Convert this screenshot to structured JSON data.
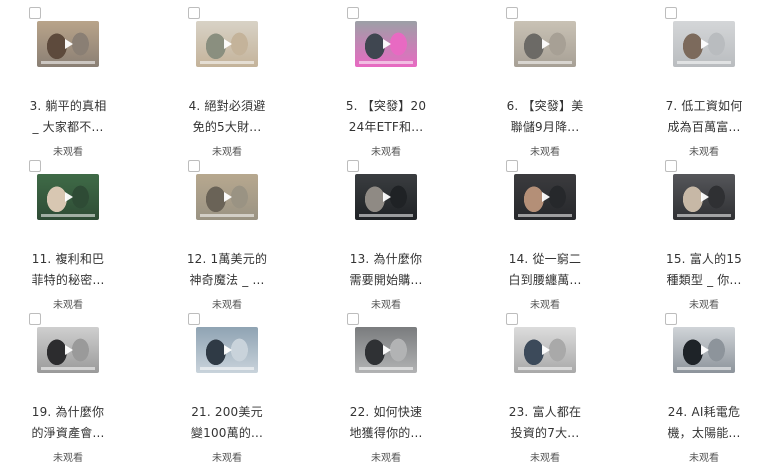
{
  "videos": [
    {
      "title_line1": "3. 躺平的真相",
      "title_line2": "_ 大家都不...",
      "status": "未观看",
      "thumb_colors": [
        "#b9a48a",
        "#5d4a3c",
        "#8a7f74"
      ]
    },
    {
      "title_line1": "4. 絕對必須避",
      "title_line2": "免的5大財...",
      "status": "未观看",
      "thumb_colors": [
        "#d8d2c6",
        "#8a8f7f",
        "#c4b39a"
      ]
    },
    {
      "title_line1": "5. 【突發】20",
      "title_line2": "24年ETF和...",
      "status": "未观看",
      "thumb_colors": [
        "#9ca0a6",
        "#3f4650",
        "#e86ac2"
      ]
    },
    {
      "title_line1": "6. 【突發】美",
      "title_line2": "聯儲9月降...",
      "status": "未观看",
      "thumb_colors": [
        "#c9c2b5",
        "#6c6a66",
        "#a7a095"
      ]
    },
    {
      "title_line1": "7. 低工資如何",
      "title_line2": "成為百萬富...",
      "status": "未观看",
      "thumb_colors": [
        "#d4d6d8",
        "#7c6a5c",
        "#b9bcbf"
      ]
    },
    {
      "title_line1": "11. 複利和巴",
      "title_line2": "菲特的秘密...",
      "status": "未观看",
      "thumb_colors": [
        "#3f6b47",
        "#d8c7b2",
        "#2e4b35"
      ]
    },
    {
      "title_line1": "12. 1萬美元的",
      "title_line2": "神奇魔法 _ ...",
      "status": "未观看",
      "thumb_colors": [
        "#b7a88f",
        "#6a6357",
        "#9a9383"
      ]
    },
    {
      "title_line1": "13. 為什麼你",
      "title_line2": "需要開始購...",
      "status": "未观看",
      "thumb_colors": [
        "#3a3d40",
        "#8f8a84",
        "#1f2225"
      ]
    },
    {
      "title_line1": "14. 從一窮二",
      "title_line2": "白到腰纏萬...",
      "status": "未观看",
      "thumb_colors": [
        "#3b3b3e",
        "#b48f77",
        "#26282b"
      ]
    },
    {
      "title_line1": "15. 富人的15",
      "title_line2": "種類型 _ 你...",
      "status": "未观看",
      "thumb_colors": [
        "#55565a",
        "#c7b8a6",
        "#2f3033"
      ]
    },
    {
      "title_line1": "19. 為什麼你",
      "title_line2": "的淨資產會...",
      "status": "未观看",
      "thumb_colors": [
        "#cfcfcf",
        "#2c2c2e",
        "#9a9a9a"
      ]
    },
    {
      "title_line1": "21. 200美元",
      "title_line2": "變100萬的...",
      "status": "未观看",
      "thumb_colors": [
        "#8fa3b3",
        "#2f3a45",
        "#c9d3db"
      ]
    },
    {
      "title_line1": "22. 如何快速",
      "title_line2": "地獲得你的...",
      "status": "未观看",
      "thumb_colors": [
        "#7a7c7e",
        "#2f3134",
        "#b2b3b4"
      ]
    },
    {
      "title_line1": "23. 富人都在",
      "title_line2": "投資的7大...",
      "status": "未观看",
      "thumb_colors": [
        "#dcdcdc",
        "#3c4a5a",
        "#a9a9a9"
      ]
    },
    {
      "title_line1": "24. AI耗電危",
      "title_line2": "機，太陽能...",
      "status": "未观看",
      "thumb_colors": [
        "#d0d4d8",
        "#1e2328",
        "#8d949b"
      ]
    }
  ]
}
